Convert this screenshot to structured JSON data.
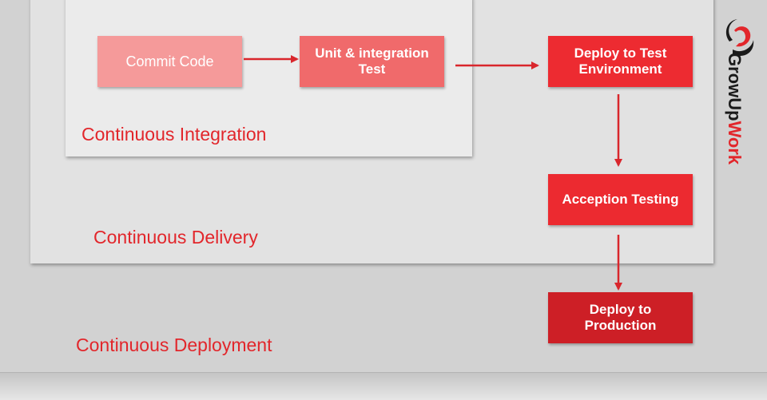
{
  "colors": {
    "accent": "#e2262b",
    "commit_box": "#f59a9a",
    "unit_box": "#f06a6b",
    "deploy_test_box": "#ed2b31",
    "acception_box": "#ec2a30",
    "production_box": "#cd1f26",
    "arrow": "#d9262c"
  },
  "stages": {
    "integration": "Continuous Integration",
    "delivery": "Continuous Delivery",
    "deployment": "Continuous Deployment"
  },
  "steps": [
    {
      "label": "Commit Code"
    },
    {
      "label": "Unit & integration\nTest"
    },
    {
      "label": "Deploy to Test\nEnvironment"
    },
    {
      "label": "Acception Testing"
    },
    {
      "label": "Deploy to\nProduction"
    }
  ],
  "logo": {
    "text_main": "GrowUp",
    "text_accent": "Work",
    "icon": "growupwork-logo-icon"
  }
}
